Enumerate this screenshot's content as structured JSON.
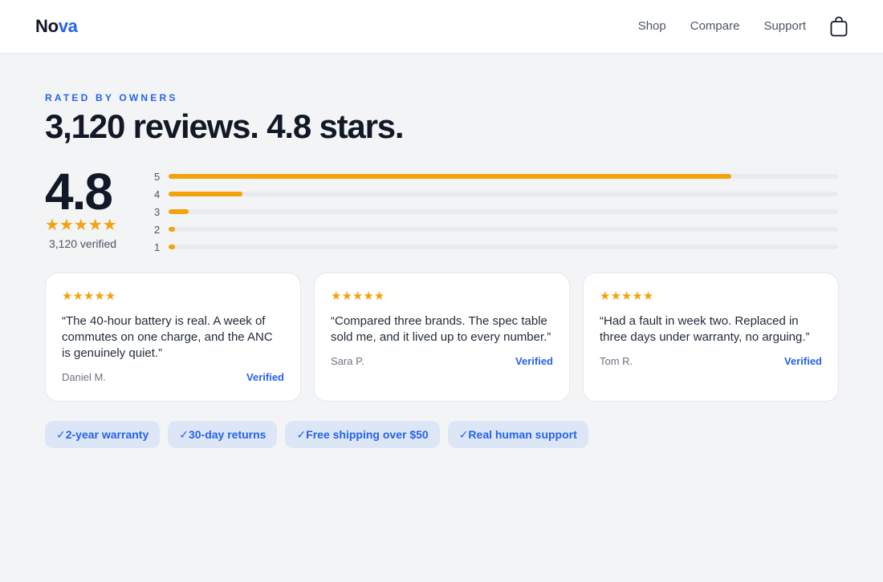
{
  "header": {
    "logo_main": "No",
    "logo_accent": "va",
    "nav": [
      "Shop",
      "Compare",
      "Support"
    ],
    "cart_icon": "shopping-bag-icon"
  },
  "hero": {
    "eyebrow": "RATED BY OWNERS",
    "headline": "3,120 reviews. 4.8 stars."
  },
  "summary": {
    "score": "4.8",
    "stars": "★★★★★",
    "verified_count": "3,120 verified"
  },
  "distribution": [
    {
      "stars": "5",
      "share": 0.84
    },
    {
      "stars": "4",
      "share": 0.11
    },
    {
      "stars": "3",
      "share": 0.03
    },
    {
      "stars": "2",
      "share": 0.01
    },
    {
      "stars": "1",
      "share": 0.01
    }
  ],
  "reviews": [
    {
      "stars": "★★★★★",
      "quote": "“The 40-hour battery is real. A week of commutes on one charge, and the ANC is genuinely quiet.”",
      "author": "Daniel M.",
      "badge": "Verified"
    },
    {
      "stars": "★★★★★",
      "quote": "“Compared three brands. The spec table sold me, and it lived up to every number.”",
      "author": "Sara P.",
      "badge": "Verified"
    },
    {
      "stars": "★★★★★",
      "quote": "“Had a fault in week two. Replaced in three days under warranty, no arguing.”",
      "author": "Tom R.",
      "badge": "Verified"
    }
  ],
  "chips": [
    "✓2-year warranty",
    "✓30-day returns",
    "✓Free shipping over $50",
    "✓Real human support"
  ],
  "colors": {
    "accent": "#2563eb",
    "star": "#f4a20c",
    "background": "#f3f4f6"
  }
}
